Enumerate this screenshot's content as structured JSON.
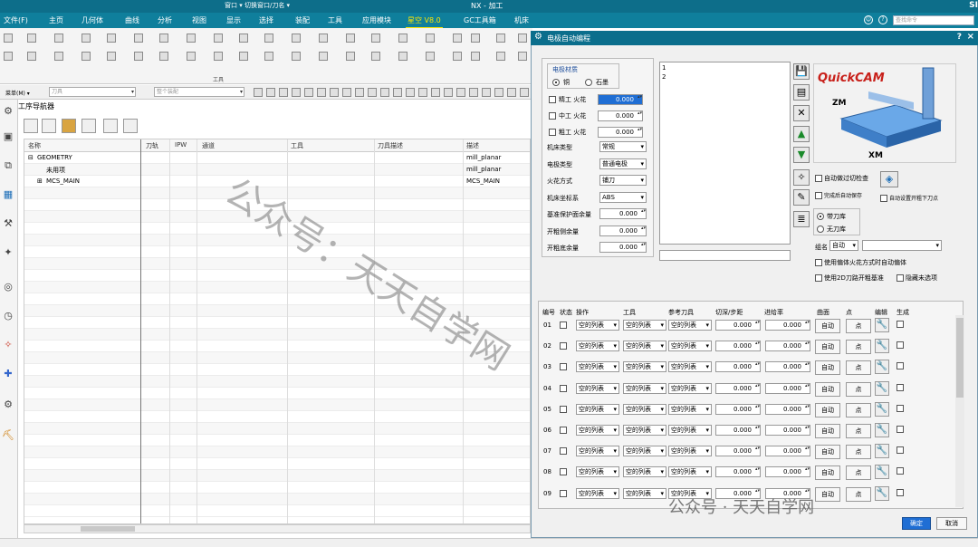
{
  "window": {
    "title": "NX - 加工",
    "quick_access": "窗口 ▾  切换窗口/刀名 ▾",
    "brand": "SI"
  },
  "menu": {
    "items": [
      "文件(F)",
      "主页",
      "几何体",
      "曲线",
      "分析",
      "视图",
      "显示",
      "选择",
      "装配",
      "工具",
      "应用模块",
      "星空 V8.0",
      "GC工具箱",
      "机床"
    ],
    "active": "星空 V8.0",
    "search_placeholder": "查找命令"
  },
  "ribbon": {
    "group_label": "工具"
  },
  "filterbar": {
    "menu_label": "菜单(M) ▾",
    "filter_placeholder": "刀具",
    "assembly_placeholder": "整个装配"
  },
  "navigator": {
    "title": "工序导航器",
    "columns": [
      "名称",
      "刀轨",
      "IPW",
      "通道",
      "工具",
      "刀具描述",
      "描述"
    ],
    "rows": [
      {
        "name": "GEOMETRY",
        "desc": "mill_planar",
        "indent": 0,
        "expander": "⊟"
      },
      {
        "name": "未用项",
        "desc": "mill_planar",
        "indent": 1,
        "expander": ""
      },
      {
        "name": "MCS_MAIN",
        "desc": "MCS_MAIN",
        "indent": 1,
        "expander": "⊞"
      }
    ]
  },
  "dialog": {
    "title": "电极自动编程",
    "help": "?",
    "close": "×",
    "material": {
      "label": "电极材质",
      "copper": "铜",
      "graphite": "石墨",
      "selected": "copper"
    },
    "spark": [
      {
        "label": "精工 火花",
        "value": "0.000",
        "checked": false,
        "highlight": true
      },
      {
        "label": "中工 火花",
        "value": "0.000",
        "checked": false,
        "highlight": false
      },
      {
        "label": "粗工 火花",
        "value": "0.000",
        "checked": false,
        "highlight": false
      }
    ],
    "params": [
      {
        "label": "机床类型",
        "type": "combo",
        "value": "常规"
      },
      {
        "label": "电极类型",
        "type": "combo",
        "value": "普通电极"
      },
      {
        "label": "火花方式",
        "type": "combo",
        "value": "铺刀"
      },
      {
        "label": "机床坐标系",
        "type": "combo",
        "value": "ABS"
      },
      {
        "label": "基准保护面余量",
        "type": "spin",
        "value": "0.000"
      },
      {
        "label": "开粗侧余量",
        "type": "spin",
        "value": "0.000"
      },
      {
        "label": "开粗底余量",
        "type": "spin",
        "value": "0.000"
      }
    ],
    "list_items": [
      "1",
      "2"
    ],
    "side_icons": [
      "save-icon",
      "settings-icon",
      "delete-icon",
      "move-up-icon",
      "move-down-icon"
    ],
    "options": {
      "auto_overcut": "自动做过切检查",
      "auto_save": "完成后自动保存",
      "auto_open_next": "自动设置开粗下刀点",
      "with_toolbox": "带刀库",
      "without_toolbox": "无刀库",
      "toolbox_selected": "with",
      "group_label": "组名",
      "group_value": "自动",
      "group_text": "",
      "use_spark_method": "使用偏体火花方式时自动偏体",
      "use_2d_open": "使用2D刀路开粗基准",
      "hide_unselected": "隐藏未选项"
    },
    "logo_text": "QuickCAM",
    "logo_axes": {
      "zm": "ZM",
      "xm": "XM"
    },
    "ops_table": {
      "headers": [
        "编号",
        "状态",
        "操作",
        "工具",
        "参考刀具",
        "切深/步距",
        "进给率",
        "曲面",
        "点",
        "编辑",
        "生成"
      ],
      "rows": [
        {
          "no": "01",
          "status": "",
          "op": "空的列表",
          "tool": "空的列表",
          "ref": "空的列表",
          "depth": "0.000",
          "feed": "0.000",
          "surf": "自动",
          "pt": "点"
        },
        {
          "no": "02",
          "status": "",
          "op": "空的列表",
          "tool": "空的列表",
          "ref": "空的列表",
          "depth": "0.000",
          "feed": "0.000",
          "surf": "自动",
          "pt": "点"
        },
        {
          "no": "03",
          "status": "",
          "op": "空的列表",
          "tool": "空的列表",
          "ref": "空的列表",
          "depth": "0.000",
          "feed": "0.000",
          "surf": "自动",
          "pt": "点"
        },
        {
          "no": "04",
          "status": "",
          "op": "空的列表",
          "tool": "空的列表",
          "ref": "空的列表",
          "depth": "0.000",
          "feed": "0.000",
          "surf": "自动",
          "pt": "点"
        },
        {
          "no": "05",
          "status": "",
          "op": "空的列表",
          "tool": "空的列表",
          "ref": "空的列表",
          "depth": "0.000",
          "feed": "0.000",
          "surf": "自动",
          "pt": "点"
        },
        {
          "no": "06",
          "status": "",
          "op": "空的列表",
          "tool": "空的列表",
          "ref": "空的列表",
          "depth": "0.000",
          "feed": "0.000",
          "surf": "自动",
          "pt": "点"
        },
        {
          "no": "07",
          "status": "",
          "op": "空的列表",
          "tool": "空的列表",
          "ref": "空的列表",
          "depth": "0.000",
          "feed": "0.000",
          "surf": "自动",
          "pt": "点"
        },
        {
          "no": "08",
          "status": "",
          "op": "空的列表",
          "tool": "空的列表",
          "ref": "空的列表",
          "depth": "0.000",
          "feed": "0.000",
          "surf": "自动",
          "pt": "点"
        },
        {
          "no": "09",
          "status": "",
          "op": "空的列表",
          "tool": "空的列表",
          "ref": "空的列表",
          "depth": "0.000",
          "feed": "0.000",
          "surf": "自动",
          "pt": "点"
        }
      ]
    },
    "ok": "确定",
    "cancel": "取消"
  },
  "watermark": {
    "main": "公众号：天天自学网",
    "footer": "公众号 · 天天自学网"
  }
}
